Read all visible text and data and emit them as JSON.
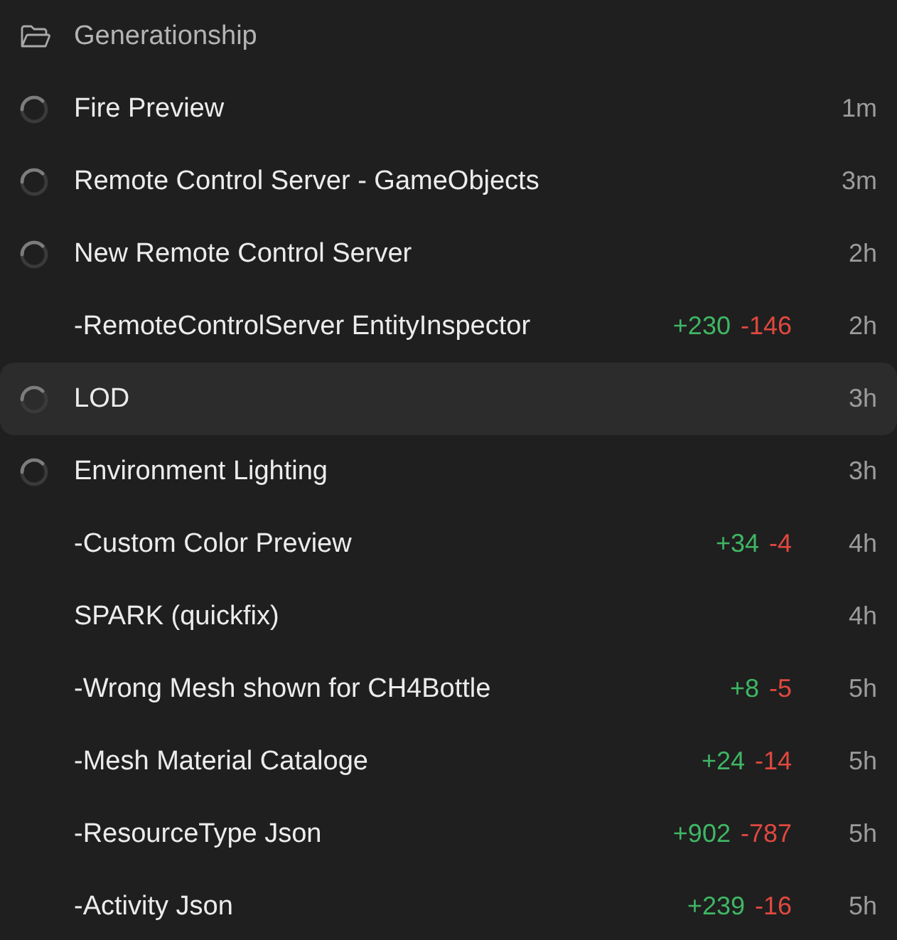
{
  "header": {
    "title": "Generationship"
  },
  "items": [
    {
      "title": "Fire Preview",
      "loading": true,
      "selected": false,
      "time": "1m"
    },
    {
      "title": "Remote Control Server - GameObjects",
      "loading": true,
      "selected": false,
      "time": "3m"
    },
    {
      "title": "New Remote Control Server",
      "loading": true,
      "selected": false,
      "time": "2h"
    },
    {
      "title": "-RemoteControlServer EntityInspector",
      "loading": false,
      "selected": false,
      "additions": "+230",
      "deletions": "-146",
      "time": "2h"
    },
    {
      "title": "LOD",
      "loading": true,
      "selected": true,
      "time": "3h"
    },
    {
      "title": "Environment Lighting",
      "loading": true,
      "selected": false,
      "time": "3h"
    },
    {
      "title": "-Custom Color Preview",
      "loading": false,
      "selected": false,
      "additions": "+34",
      "deletions": "-4",
      "time": "4h"
    },
    {
      "title": "SPARK (quickfix)",
      "loading": false,
      "selected": false,
      "time": "4h"
    },
    {
      "title": "-Wrong Mesh shown for CH4Bottle",
      "loading": false,
      "selected": false,
      "additions": "+8",
      "deletions": "-5",
      "time": "5h"
    },
    {
      "title": "-Mesh Material Cataloge",
      "loading": false,
      "selected": false,
      "additions": "+24",
      "deletions": "-14",
      "time": "5h"
    },
    {
      "title": "-ResourceType Json",
      "loading": false,
      "selected": false,
      "additions": "+902",
      "deletions": "-787",
      "time": "5h"
    },
    {
      "title": "-Activity Json",
      "loading": false,
      "selected": false,
      "additions": "+239",
      "deletions": "-16",
      "time": "5h"
    }
  ]
}
